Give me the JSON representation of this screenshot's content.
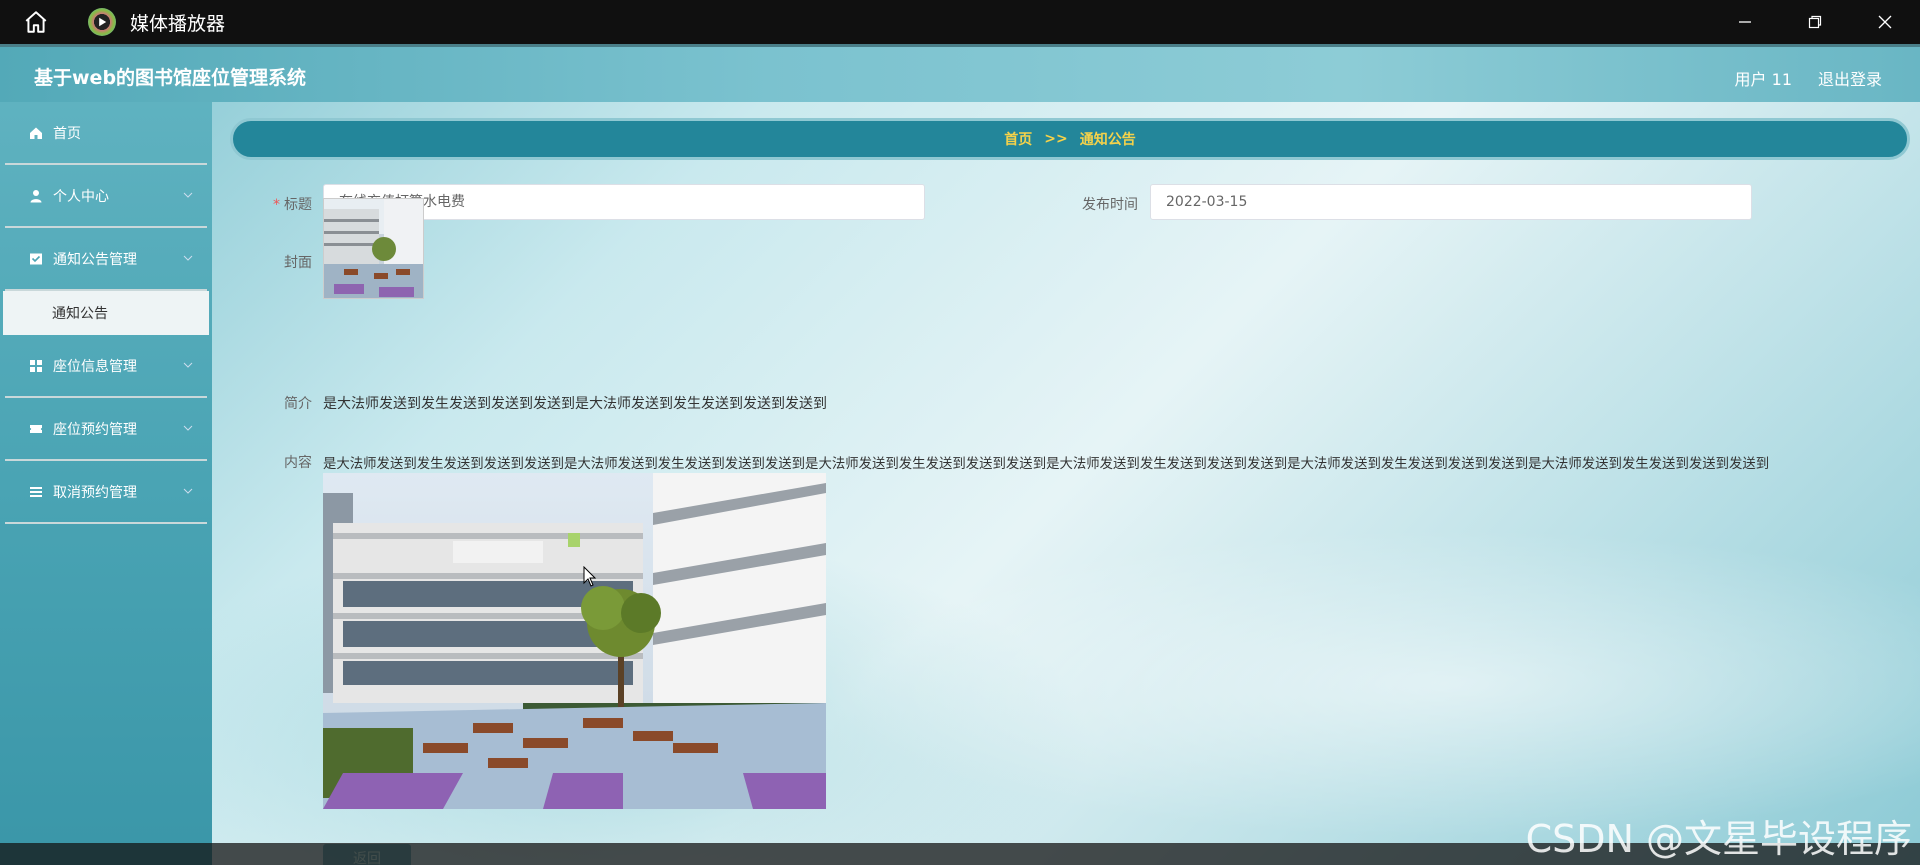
{
  "player": {
    "title": "媒体播放器"
  },
  "app": {
    "system_title": "基于web的图书馆座位管理系统",
    "user_label": "用户 11",
    "logout_label": "退出登录"
  },
  "sidebar": {
    "items": [
      {
        "label": "首页",
        "icon": "home-icon"
      },
      {
        "label": "个人中心",
        "icon": "user-icon"
      },
      {
        "label": "通知公告管理",
        "icon": "notice-icon"
      },
      {
        "label": "座位信息管理",
        "icon": "grid-icon"
      },
      {
        "label": "座位预约管理",
        "icon": "ticket-icon"
      },
      {
        "label": "取消预约管理",
        "icon": "list-icon"
      }
    ],
    "submenu_active": "通知公告"
  },
  "breadcrumb": {
    "home": "首页",
    "separator": ">>",
    "current": "通知公告"
  },
  "form": {
    "title_label": "标题",
    "title_value": "在线充值打算水电费",
    "date_label": "发布时间",
    "date_value": "2022-03-15",
    "cover_label": "封面",
    "intro_label": "简介",
    "intro_value": "是大法师发送到发生发送到发送到发送到是大法师发送到发生发送到发送到发送到",
    "content_label": "内容",
    "content_value": "是大法师发送到发生发送到发送到发送到是大法师发送到发生发送到发送到发送到是大法师发送到发生发送到发送到发送到是大法师发送到发生发送到发送到发送到是大法师发送到发生发送到发送到发送到是大法师发送到发生发送到发送到发送到",
    "back_label": "返回"
  },
  "watermark": "CSDN @文星毕设程序",
  "colors": {
    "breadcrumb_bg": "#23869a",
    "breadcrumb_text": "#f5d24a",
    "sidebar_bg": "#4aa4b4"
  }
}
